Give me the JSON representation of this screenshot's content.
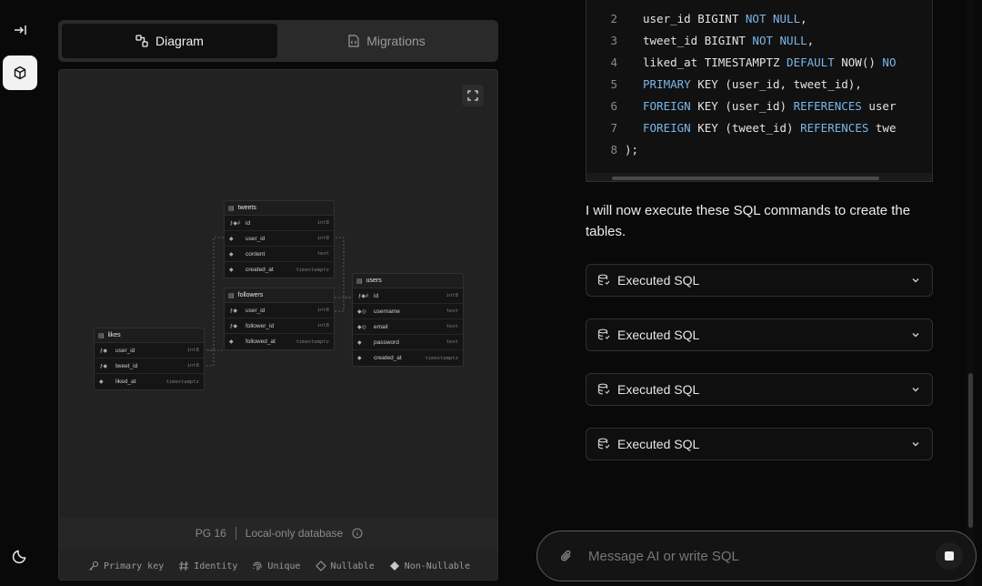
{
  "tabs": [
    {
      "label": "Diagram",
      "icon": "diagram-icon",
      "active": true
    },
    {
      "label": "Migrations",
      "icon": "file-code-icon",
      "active": false
    }
  ],
  "db_info": {
    "version": "PG 16",
    "mode": "Local-only database"
  },
  "legend": {
    "primary_key": "Primary key",
    "identity": "Identity",
    "unique": "Unique",
    "nullable": "Nullable",
    "non_nullable": "Non-Nullable"
  },
  "er": {
    "tweets": {
      "name": "tweets",
      "columns": [
        {
          "name": "id",
          "type": "int8"
        },
        {
          "name": "user_id",
          "type": "int8"
        },
        {
          "name": "content",
          "type": "text"
        },
        {
          "name": "created_at",
          "type": "timestamptz"
        }
      ]
    },
    "followers": {
      "name": "followers",
      "columns": [
        {
          "name": "user_id",
          "type": "int8"
        },
        {
          "name": "follower_id",
          "type": "int8"
        },
        {
          "name": "followed_at",
          "type": "timestamptz"
        }
      ]
    },
    "users": {
      "name": "users",
      "columns": [
        {
          "name": "id",
          "type": "int8"
        },
        {
          "name": "username",
          "type": "text"
        },
        {
          "name": "email",
          "type": "text"
        },
        {
          "name": "password",
          "type": "text"
        },
        {
          "name": "created_at",
          "type": "timestamptz"
        }
      ]
    },
    "likes": {
      "name": "likes",
      "columns": [
        {
          "name": "user_id",
          "type": "int8"
        },
        {
          "name": "tweet_id",
          "type": "int8"
        },
        {
          "name": "liked_at",
          "type": "timestamptz"
        }
      ]
    }
  },
  "code": {
    "lines": [
      {
        "n": "2",
        "parts": [
          [
            "user_id BIGINT ",
            ""
          ],
          [
            "NOT NULL",
            "kw"
          ],
          [
            ",",
            ""
          ]
        ]
      },
      {
        "n": "3",
        "parts": [
          [
            "tweet_id BIGINT ",
            ""
          ],
          [
            "NOT NULL",
            "kw"
          ],
          [
            ",",
            ""
          ]
        ]
      },
      {
        "n": "4",
        "parts": [
          [
            "liked_at TIMESTAMPTZ ",
            ""
          ],
          [
            "DEFAULT",
            "kw"
          ],
          [
            " NOW() ",
            ""
          ],
          [
            "NO",
            "kw"
          ]
        ]
      },
      {
        "n": "5",
        "parts": [
          [
            "PRIMARY",
            "kw"
          ],
          [
            " KEY (user_id, tweet_id),",
            ""
          ]
        ]
      },
      {
        "n": "6",
        "parts": [
          [
            "FOREIGN",
            "kw"
          ],
          [
            " KEY (user_id) ",
            ""
          ],
          [
            "REFERENCES",
            "kw"
          ],
          [
            " user",
            ""
          ]
        ]
      },
      {
        "n": "7",
        "parts": [
          [
            "FOREIGN",
            "kw"
          ],
          [
            " KEY (tweet_id) ",
            ""
          ],
          [
            "REFERENCES",
            "kw"
          ],
          [
            " twe",
            ""
          ]
        ]
      },
      {
        "n": "8",
        "parts": [
          [
            ");",
            ""
          ]
        ]
      }
    ]
  },
  "assistant_message": "I will now execute these SQL commands to create the tables.",
  "executed_items": [
    {
      "label": "Executed SQL"
    },
    {
      "label": "Executed SQL"
    },
    {
      "label": "Executed SQL"
    },
    {
      "label": "Executed SQL"
    }
  ],
  "composer": {
    "placeholder": "Message AI or write SQL"
  },
  "colors": {
    "accent_keyword": "#7ab6e8",
    "background": "#090909",
    "panel": "#232323"
  }
}
